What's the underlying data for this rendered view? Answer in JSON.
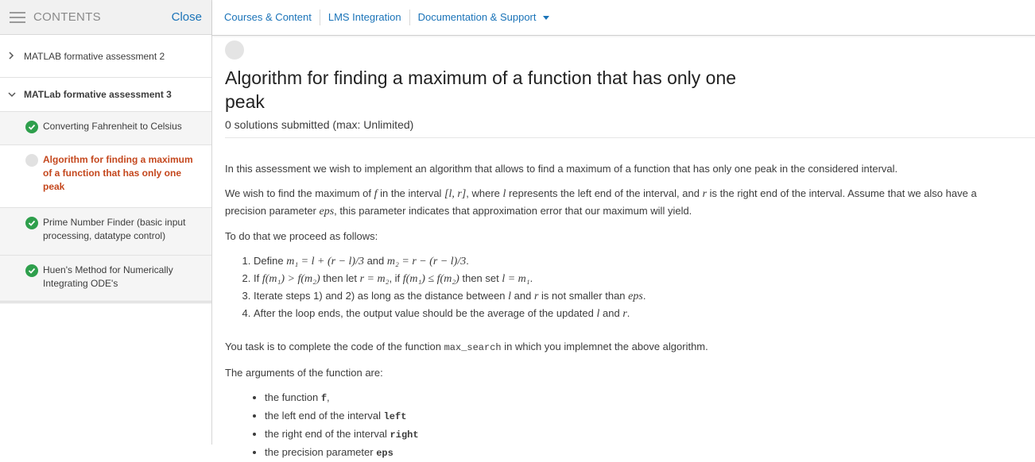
{
  "sidebar": {
    "header_label": "CONTENTS",
    "close_label": "Close",
    "items": [
      {
        "label": "MATLAB formative assessment 2",
        "chevron": "›"
      },
      {
        "label": "MATLab formative assessment 3",
        "chevron": "⌄"
      }
    ],
    "subitems": [
      {
        "label": "Converting Fahrenheit to Celsius",
        "status": "complete"
      },
      {
        "label": "Algorithm for finding a maximum of a function that has only one peak",
        "status": "active"
      },
      {
        "label": "Prime Number Finder (basic input processing, datatype control)",
        "status": "complete"
      },
      {
        "label": "Huen's Method for Numerically Integrating ODE's",
        "status": "complete"
      }
    ]
  },
  "nav": {
    "links": [
      "Courses & Content",
      "LMS Integration",
      "Documentation & Support"
    ]
  },
  "main": {
    "title": "Algorithm for finding a maximum of a function that has only one peak",
    "submissions": "0 solutions submitted (max: Unlimited)",
    "intro": "In this assessment we wish to implement an algorithm that allows to find a maximum of a function that has only one peak in the considered interval.",
    "p2": {
      "a": "We wish to find the maximum of ",
      "f": "f",
      "b": " in the interval ",
      "interval": "[l, r]",
      "c": ", where ",
      "l": "l",
      "d": " represents the left end of the interval, and ",
      "r": "r",
      "e": " is the right end of the interval. Assume that we also have a precision parameter ",
      "eps": "eps",
      "g": ", this parameter indicates that approximation error that our maximum will yield."
    },
    "p3": "To do that we proceed as follows:",
    "steps": {
      "s1a": "Define ",
      "s1m1": "m₁ = l + (r − l)/3",
      "s1b": " and ",
      "s1m2": "m₂ = r − (r − l)/3",
      "s1c": ".",
      "s2a": "If ",
      "s2c1": "f(m₁) > f(m₂)",
      "s2b": " then let ",
      "s2m": "r = m₂",
      "s2c": ", if ",
      "s2c2": "f(m₁) ≤ f(m₂)",
      "s2d": " then set ",
      "s2m2": "l = m₁",
      "s2e": ".",
      "s3a": "Iterate steps 1) and 2) as long as the distance between ",
      "s3l": "l",
      "s3b": " and ",
      "s3r": "r",
      "s3c": " is not smaller than ",
      "s3eps": "eps",
      "s3d": ".",
      "s4a": "After the loop ends, the output value should be the average of the updated ",
      "s4l": "l",
      "s4b": " and ",
      "s4r": "r",
      "s4c": "."
    },
    "task_a": "You task is to complete the code of the function ",
    "task_code": "max_search",
    "task_b": " in which you implemnet the above algorithm.",
    "args_intro": "The arguments of the function are:",
    "args": [
      {
        "text": "the function ",
        "code": "f",
        "tail": ","
      },
      {
        "text": "the left end of the interval ",
        "code": "left",
        "tail": ""
      },
      {
        "text": "the right end of the interval ",
        "code": "right",
        "tail": ""
      },
      {
        "text": "the precision parameter ",
        "code": "eps",
        "tail": ""
      }
    ]
  }
}
